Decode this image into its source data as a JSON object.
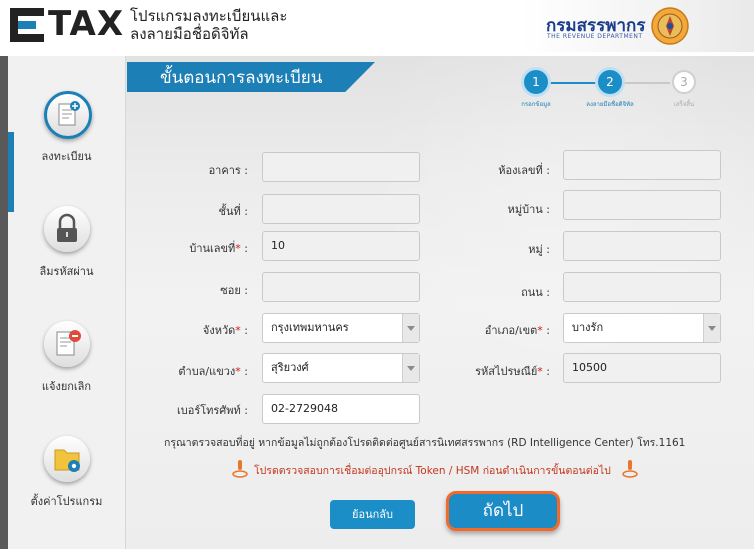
{
  "header": {
    "logo_text": "TAX",
    "title_line1": "โปรแกรมลงทะเบียนและ",
    "title_line2": "ลงลายมือชื่อดิจิทัล",
    "rd_name": "กรมสรรพากร",
    "rd_sub": "THE REVENUE DEPARTMENT"
  },
  "sidebar": {
    "items": [
      {
        "label": "ลงทะเบียน",
        "icon": "register-document-icon",
        "active": true
      },
      {
        "label": "ลืมรหัสผ่าน",
        "icon": "lock-icon",
        "active": false
      },
      {
        "label": "แจ้งยกเลิก",
        "icon": "cancel-document-icon",
        "active": false
      },
      {
        "label": "ตั้งค่าโปรแกรม",
        "icon": "settings-folder-icon",
        "active": false
      }
    ]
  },
  "page": {
    "title": "ขั้นตอนการลงทะเบียน"
  },
  "steps": [
    {
      "number": "1",
      "label": "กรอกข้อมูล",
      "state": "done"
    },
    {
      "number": "2",
      "label": "ลงลายมือชื่อดิจิทัล",
      "state": "current"
    },
    {
      "number": "3",
      "label": "เสร็จสิ้น",
      "state": "pending"
    }
  ],
  "form": {
    "building": {
      "label": "อาคาร",
      "value": ""
    },
    "room_no": {
      "label": "ห้องเลขที่",
      "value": ""
    },
    "floor": {
      "label": "ชั้นที่",
      "value": ""
    },
    "village": {
      "label": "หมู่บ้าน",
      "value": ""
    },
    "house_no": {
      "label": "บ้านเลขที่",
      "value": "10"
    },
    "moo": {
      "label": "หมู่",
      "value": ""
    },
    "soi": {
      "label": "ซอย",
      "value": ""
    },
    "road": {
      "label": "ถนน",
      "value": ""
    },
    "province": {
      "label": "จังหวัด",
      "value": "กรุงเทพมหานคร"
    },
    "district": {
      "label": "อำเภอ/เขต",
      "value": "บางรัก"
    },
    "subdistrict": {
      "label": "ตำบล/แขวง",
      "value": "สุริยวงศ์"
    },
    "postcode": {
      "label": "รหัสไปรษณีย์",
      "value": "10500"
    },
    "phone": {
      "label": "เบอร์โทรศัพท์",
      "value": "02-2729048"
    }
  },
  "notes": {
    "info": "กรุณาตรวจสอบที่อยู่ หากข้อมูลไม่ถูกต้องโปรดติดต่อศูนย์สารนิเทศสรรพากร (RD Intelligence Center) โทร.1161",
    "warning": "โปรดตรวจสอบการเชื่อมต่ออุปกรณ์ Token / HSM ก่อนดำเนินการขั้นตอนต่อไป"
  },
  "buttons": {
    "back": "ย้อนกลับ",
    "next": "ถัดไป"
  },
  "colors": {
    "primary": "#1c7fb6",
    "accent": "#f26a2a",
    "required": "#d01818",
    "warning": "#c4351d"
  }
}
